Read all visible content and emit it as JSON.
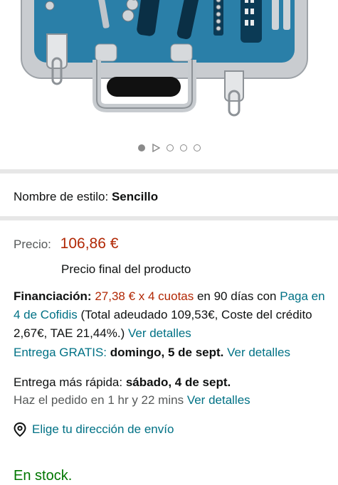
{
  "carousel": {
    "image_icon": "tool-case-icon",
    "dots": [
      "active",
      "video",
      "inactive",
      "inactive",
      "inactive"
    ]
  },
  "style": {
    "label": "Nombre de estilo:",
    "value": "Sencillo"
  },
  "price": {
    "label": "Precio:",
    "value": "106,86 €",
    "final_note": "Precio final del producto"
  },
  "financing": {
    "label": "Financiación:",
    "amount": "27,38 € x 4 cuotas",
    "term": " en 90 días con ",
    "link": "Paga en 4 de Cofidis",
    "details": " (Total adeudado 109,53€, Coste del crédito 2,67€, TAE 21,44%.) ",
    "details_link": "Ver detalles"
  },
  "delivery": {
    "label": "Entrega GRATIS:",
    "date": "domingo, 5 de sept.",
    "link": "Ver detalles"
  },
  "fastest": {
    "label": "Entrega más rápida:",
    "date": "sábado, 4 de sept.",
    "order_text": "Haz el pedido en 1 hr y 22 mins",
    "link": "Ver detalles"
  },
  "address": {
    "icon": "location-pin-icon",
    "label": "Elige tu dirección de envío"
  },
  "stock": {
    "label": "En stock."
  },
  "colors": {
    "price_red": "#b12704",
    "link_teal": "#007185",
    "stock_green": "#007600",
    "case_blue": "#2a7fa8"
  }
}
